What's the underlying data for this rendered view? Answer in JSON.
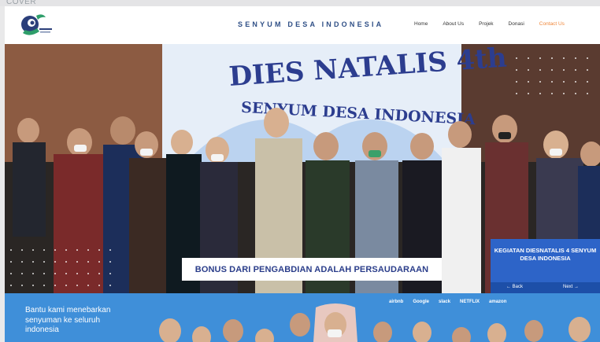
{
  "top_label": "COVER",
  "brand": {
    "title": "SENYUM DESA INDONESIA"
  },
  "nav": {
    "items": [
      {
        "label": "Home"
      },
      {
        "label": "About Us"
      },
      {
        "label": "Projek"
      },
      {
        "label": "Donasi"
      },
      {
        "label": "Contact Us"
      }
    ]
  },
  "hero": {
    "banner_title": "DIES NATALIS 4th",
    "banner_subtitle": "SENYUM DESA INDONESIA",
    "caption": "BONUS DARI PENGABDIAN ADALAH PERSAUDARAAN",
    "card_title": "KEGIATAN DIESNATALIS 4 SENYUM DESA INDONESIA",
    "back_label": "Back",
    "next_label": "Next"
  },
  "section2": {
    "cta_text": "Bantu kami menebarkan senyuman ke seluruh indonesia",
    "partners": [
      "airbnb",
      "Google",
      "slack",
      "NETFLIX",
      "amazon"
    ]
  },
  "colors": {
    "brand_blue": "#2f4f86",
    "nav_active": "#f0873a",
    "caption_text": "#2a3d8a",
    "card_blue": "#2d64c8",
    "section_blue": "#3f8fd9"
  }
}
